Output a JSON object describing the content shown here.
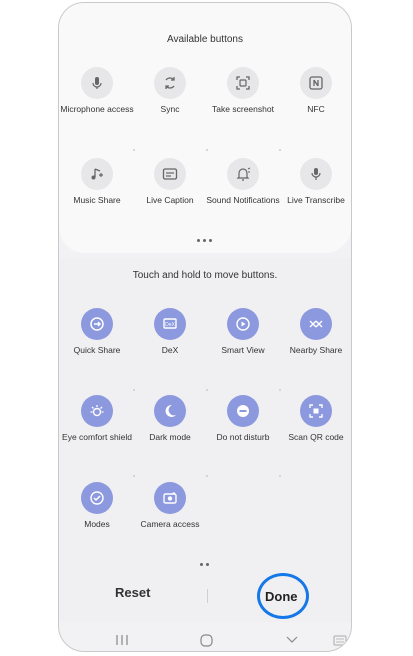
{
  "available": {
    "title": "Available buttons",
    "tiles": [
      {
        "label": "Microphone access",
        "icon": "microphone-icon"
      },
      {
        "label": "Sync",
        "icon": "sync-icon"
      },
      {
        "label": "Take screenshot",
        "icon": "screenshot-icon"
      },
      {
        "label": "NFC",
        "icon": "nfc-icon"
      },
      {
        "label": "Music Share",
        "icon": "music-share-icon"
      },
      {
        "label": "Live Caption",
        "icon": "live-caption-icon"
      },
      {
        "label": "Sound Notifications",
        "icon": "sound-notifications-icon"
      },
      {
        "label": "Live Transcribe",
        "icon": "live-transcribe-icon"
      }
    ]
  },
  "active": {
    "hint": "Touch and hold to move buttons.",
    "tiles": [
      {
        "label": "Quick Share",
        "icon": "quick-share-icon"
      },
      {
        "label": "DeX",
        "icon": "dex-icon"
      },
      {
        "label": "Smart View",
        "icon": "smart-view-icon"
      },
      {
        "label": "Nearby Share",
        "icon": "nearby-share-icon"
      },
      {
        "label": "Eye comfort shield",
        "icon": "eye-comfort-icon"
      },
      {
        "label": "Dark mode",
        "icon": "dark-mode-icon"
      },
      {
        "label": "Do not disturb",
        "icon": "do-not-disturb-icon"
      },
      {
        "label": "Scan QR code",
        "icon": "scan-qr-icon"
      },
      {
        "label": "Modes",
        "icon": "modes-icon"
      },
      {
        "label": "Camera access",
        "icon": "camera-access-icon"
      }
    ]
  },
  "footer": {
    "reset_label": "Reset",
    "done_label": "Done"
  },
  "colors": {
    "accent_circle": "#8c99de",
    "done_highlight": "#1677e8"
  }
}
